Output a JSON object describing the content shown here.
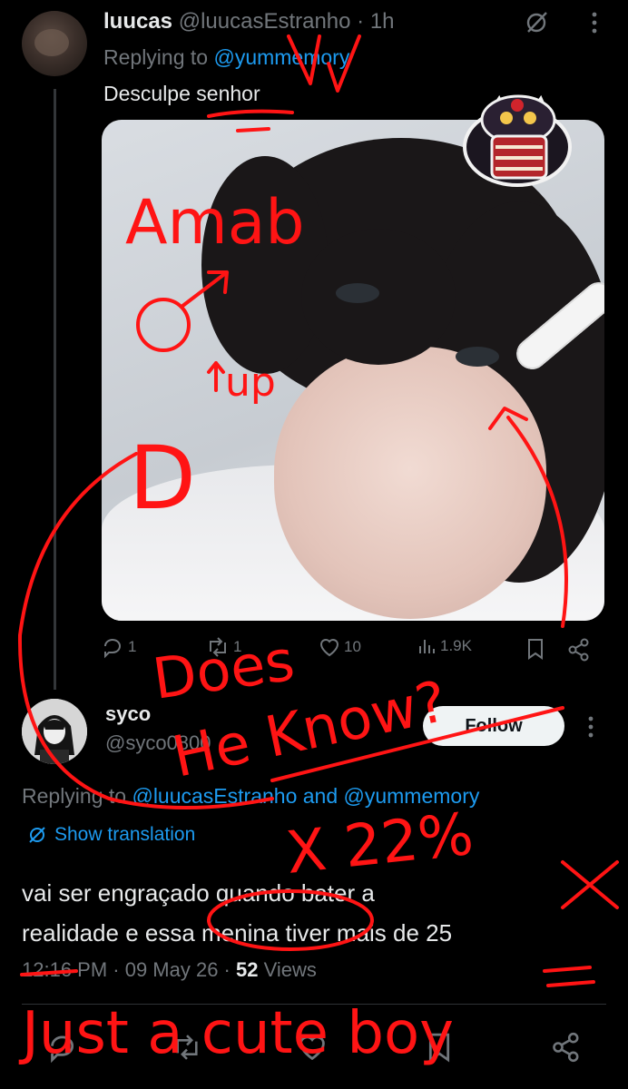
{
  "tweet1": {
    "display_name": "luucas",
    "handle": "@luucasEstranho",
    "time": "· 1h",
    "replying_prefix": "Replying to ",
    "replying_to": "@yummemory",
    "text": "Desculpe senhor",
    "actions": {
      "reply_count": "1",
      "retweet_count": "1",
      "like_count": "10",
      "views_count": "1.9K"
    }
  },
  "tweet2": {
    "display_name": "syco",
    "handle": "@syco0800",
    "follow_label": "Follow",
    "replying_prefix": "Replying to ",
    "replying_to": "@luucasEstranho and @yummemory",
    "show_translation": "Show translation",
    "text_line1": "vai ser engraçado quando bater a",
    "text_line2": "realidade e essa menina tiver mais de 25",
    "time": "12:16 PM · 09 May 26 · ",
    "views_count": "52",
    "views_label": " Views"
  },
  "annotations": {
    "amab": "Amab",
    "up": "up",
    "d": "D",
    "does": "Does",
    "he_know": "He Know?",
    "x_22_x": "X 22%",
    "just_a_cute_boy": "Just a cute boy"
  },
  "colors": {
    "background": "#000000",
    "text_primary": "#e7e9ea",
    "text_secondary": "#71767b",
    "link": "#1d9bf0",
    "ink": "#ff1414"
  },
  "icons": [
    "grok-icon",
    "more-icon",
    "reply-icon",
    "retweet-icon",
    "like-icon",
    "views-icon",
    "bookmark-icon",
    "share-icon",
    "translate-icon"
  ]
}
